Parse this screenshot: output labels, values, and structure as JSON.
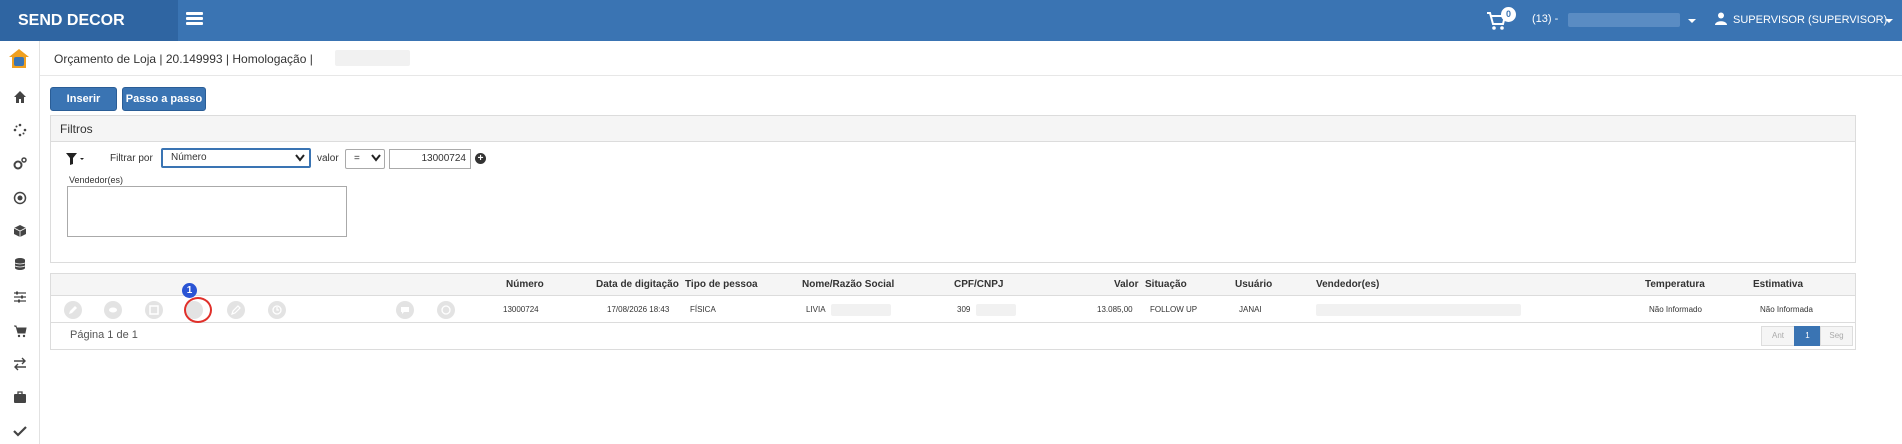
{
  "app": {
    "brand": "SEND DECOR"
  },
  "header": {
    "cart_count": "0",
    "store_code": "(13) -",
    "user": "SUPERVISOR (SUPERVISOR)"
  },
  "sidebar": {
    "items": [
      "home-icon",
      "spinner-icon",
      "cogs-icon",
      "target-icon",
      "cube-icon",
      "database-icon",
      "sliders-icon",
      "cart-icon",
      "exchange-icon",
      "briefcase-icon",
      "check-icon"
    ]
  },
  "page": {
    "title": "Orçamento de Loja | 20.149993 | Homologação |"
  },
  "toolbar": {
    "insert_label": "Inserir",
    "steps_label": "Passo a passo"
  },
  "filters": {
    "title": "Filtros",
    "filter_by_label": "Filtrar por",
    "filter_by_value": "Número",
    "value_label": "valor",
    "operator": "=",
    "value": "13000724",
    "sellers_label": "Vendedor(es)",
    "sellers_value": ""
  },
  "grid": {
    "columns": [
      "Número",
      "Data de digitação",
      "Tipo de pessoa",
      "Nome/Razão Social",
      "CPF/CNPJ",
      "Valor",
      "Situação",
      "Usuário",
      "Vendedor(es)",
      "Temperatura",
      "Estimativa"
    ],
    "rows": [
      {
        "numero": "13000724",
        "data": "17/08/2026 18:43",
        "tipo": "FÍSICA",
        "nome": "LIVIA",
        "cpf": "309",
        "valor": "13.085,00",
        "situacao": "FOLLOW UP",
        "usuario": "JANAI",
        "vendedores": "",
        "temperatura": "Não Informado",
        "estimativa": "Não Informada"
      }
    ],
    "row_actions": [
      "pencil-icon",
      "eye-icon",
      "link-icon",
      "blank-icon",
      "edit-icon",
      "clock-icon",
      "comment-icon",
      "globe-icon"
    ],
    "highlight_marker": "1",
    "pagination": {
      "text": "Página 1 de 1",
      "prev": "Ant",
      "current": "1",
      "next": "Seg"
    }
  }
}
